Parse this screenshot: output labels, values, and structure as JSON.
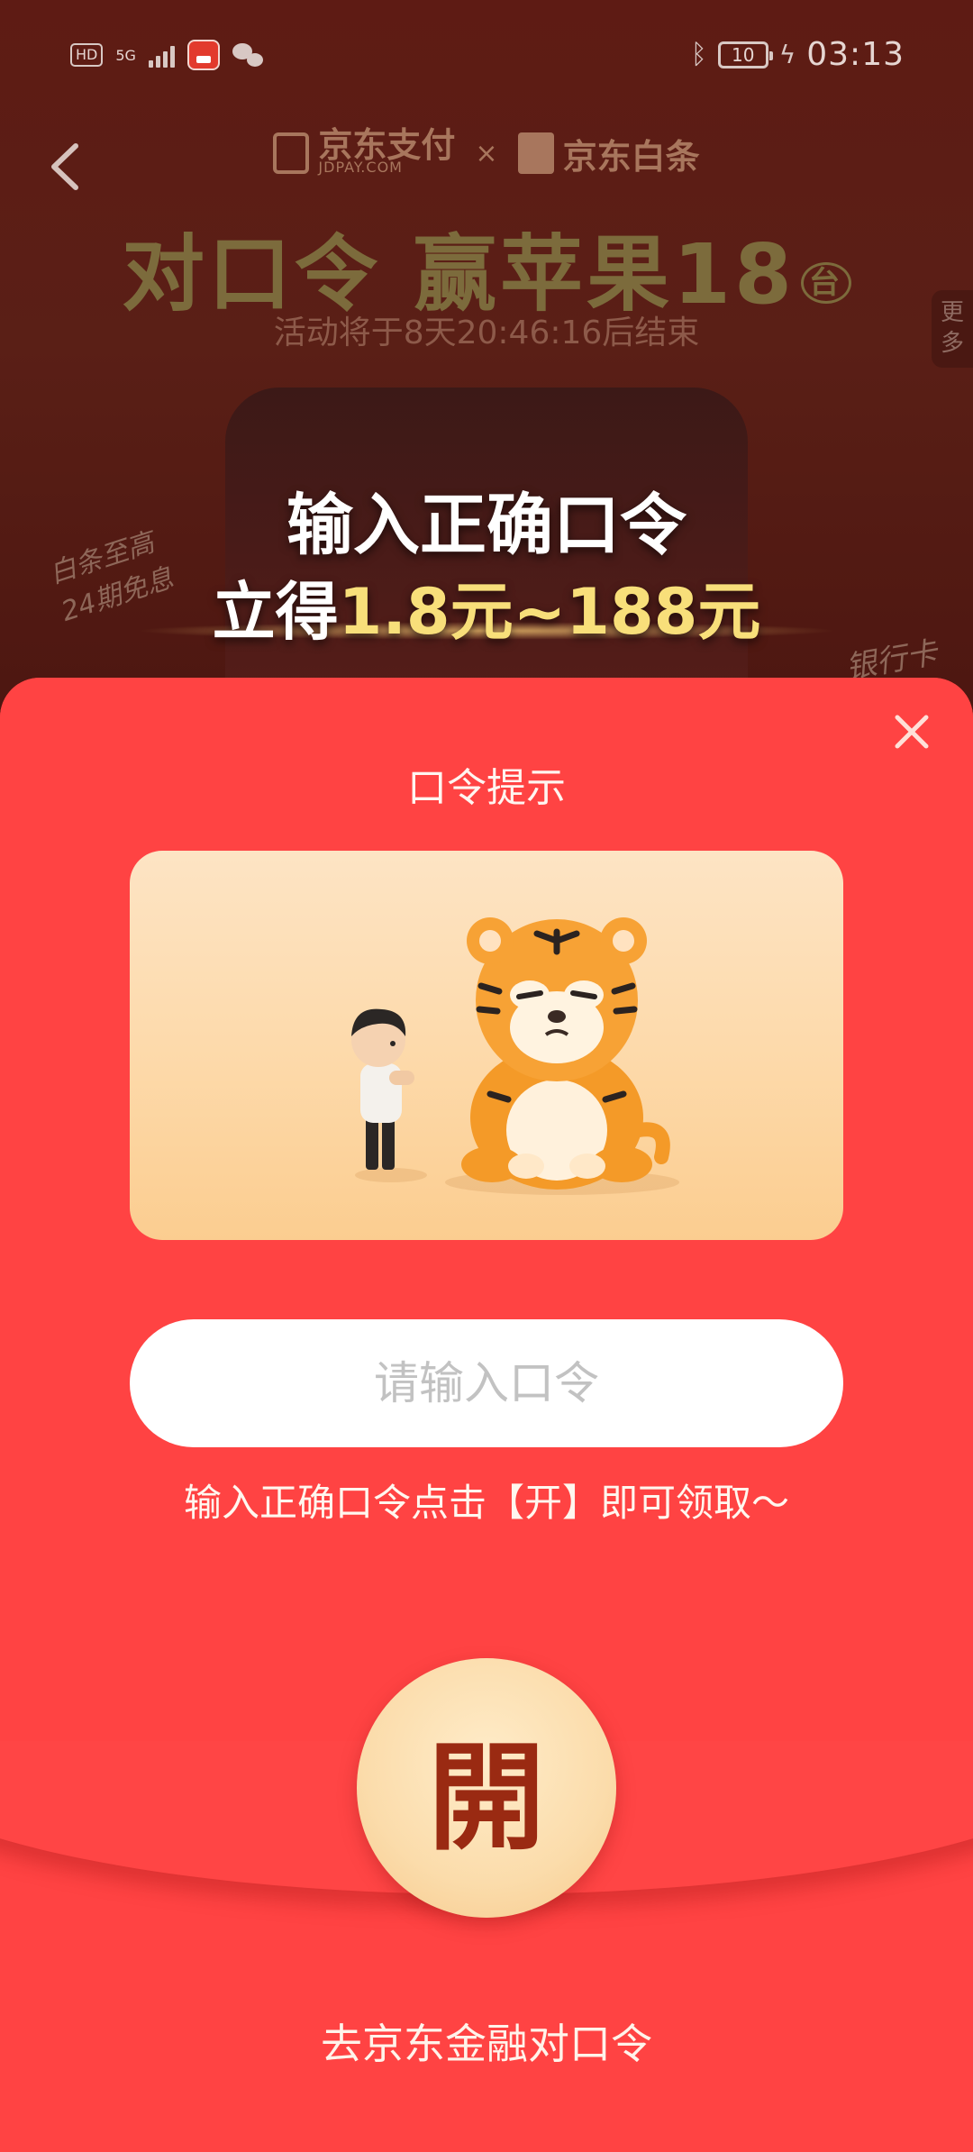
{
  "status_bar": {
    "network_badge": "HD",
    "network_type": "5G",
    "battery": "10",
    "time": "03:13"
  },
  "background": {
    "brand_jdpay": "京东支付",
    "brand_jdpay_sub": "JDPAY.COM",
    "brand_separator": "×",
    "brand_baitiao": "京东白条",
    "title": "对口令 赢苹果18",
    "title_badge": "台",
    "countdown": "活动将于8天20:46:16后结束",
    "more_tab": "更多",
    "promo_line1": "输入正确口令",
    "promo_line2_prefix": "立得",
    "promo_line2_amount": "1.8元~188元",
    "deco_left": "白条至高24期免息",
    "deco_right": "银行卡"
  },
  "modal": {
    "title": "口令提示",
    "input_placeholder": "请输入口令",
    "input_value": "",
    "tip": "输入正确口令点击【开】即可领取～",
    "open_button": "開",
    "link": "去京东金融对口令"
  },
  "colors": {
    "envelope_red": "#ff4343",
    "open_button_gold": "#fbdcab",
    "promo_gold": "#f8df7a"
  },
  "icons": {
    "back": "chevron-left-icon",
    "close": "close-icon",
    "bluetooth": "bluetooth-icon"
  }
}
